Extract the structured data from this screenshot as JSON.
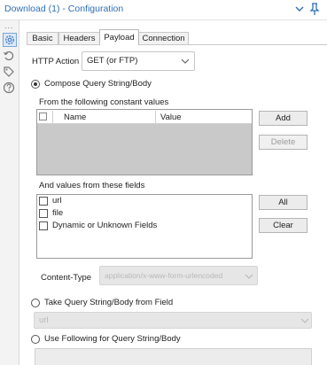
{
  "window": {
    "title": "Download (1) - Configuration"
  },
  "rail": {
    "dots": "..."
  },
  "tabs": [
    {
      "label": "Basic",
      "selected": false
    },
    {
      "label": "Headers",
      "selected": false
    },
    {
      "label": "Payload",
      "selected": true
    },
    {
      "label": "Connection",
      "selected": false
    }
  ],
  "http_action": {
    "label": "HTTP Action",
    "value": "GET (or FTP)"
  },
  "compose": {
    "label": "Compose Query String/Body",
    "checked": true,
    "constants_label": "From the following constant values",
    "columns": [
      "Name",
      "Value"
    ],
    "add_label": "Add",
    "delete_label": "Delete",
    "fields_label": "And values from these fields",
    "fields": [
      {
        "label": "url",
        "checked": false
      },
      {
        "label": "file",
        "checked": false
      },
      {
        "label": "Dynamic or Unknown Fields",
        "checked": false
      }
    ],
    "all_label": "All",
    "clear_label": "Clear",
    "content_type_label": "Content-Type",
    "content_type_value": "application/x-www-form-urlencoded"
  },
  "take_field": {
    "label": "Take Query String/Body from Field",
    "checked": false,
    "value": "url"
  },
  "use_following": {
    "label": "Use Following for Query String/Body",
    "checked": false
  },
  "colors": {
    "title": "#2f6fb5",
    "accent_icon": "#3c78c2"
  }
}
